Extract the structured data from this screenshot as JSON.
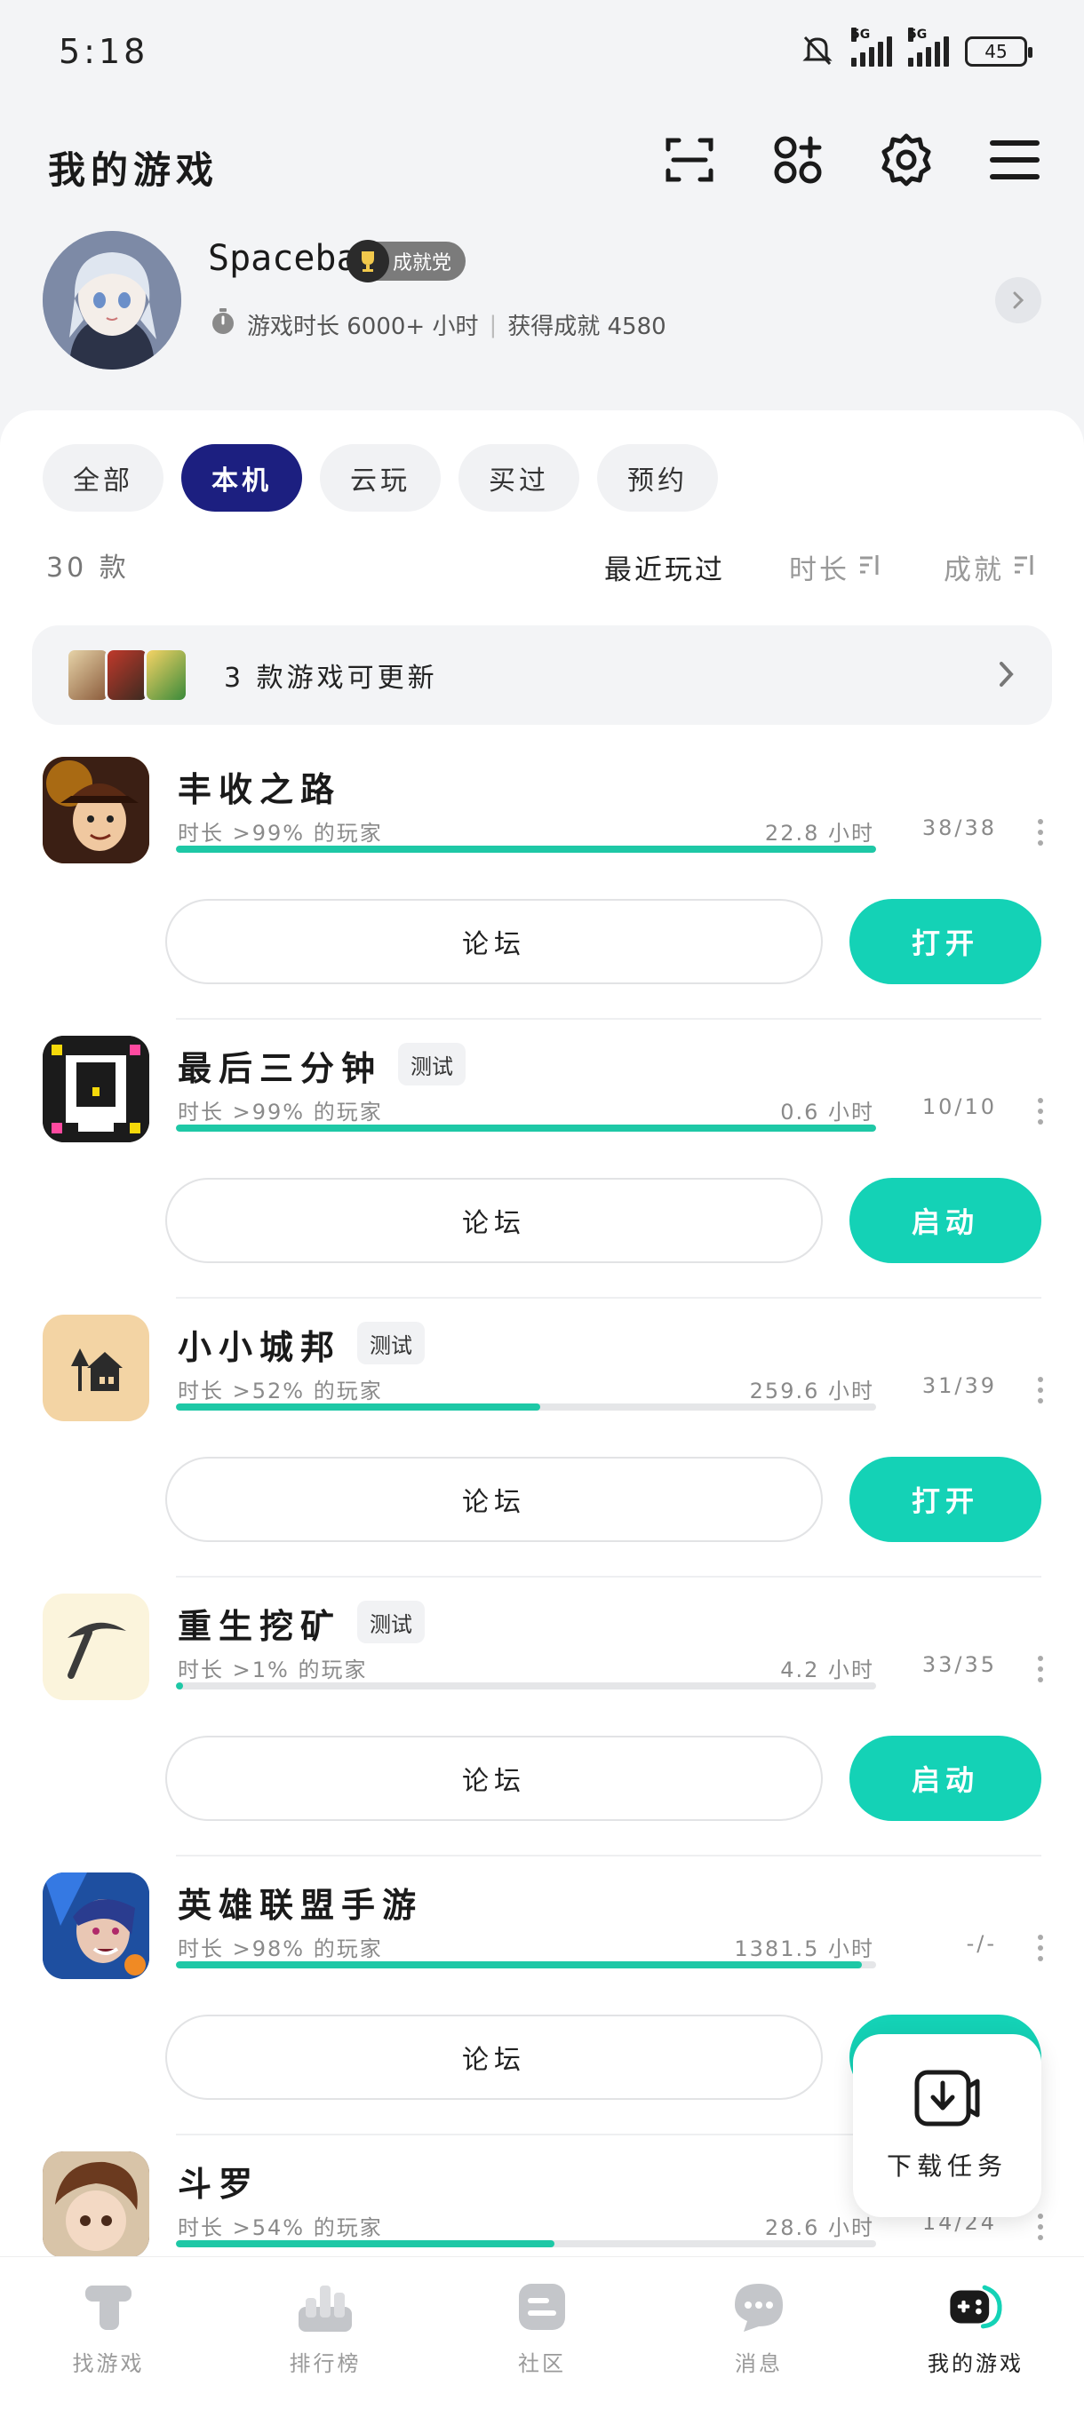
{
  "status_bar": {
    "time": "5:18",
    "network_1": "5G",
    "network_2": "5G",
    "battery": "45"
  },
  "header": {
    "title": "我的游戏"
  },
  "profile": {
    "username": "Spacebar",
    "badge_label": "成就党",
    "stats_playtime": "游戏时长 6000+ 小时",
    "stats_separator": "|",
    "stats_achievements": "获得成就 4580"
  },
  "filters": {
    "tabs": [
      {
        "label": "全部"
      },
      {
        "label": "本机"
      },
      {
        "label": "云玩"
      },
      {
        "label": "买过"
      },
      {
        "label": "预约"
      }
    ],
    "active_index": 1
  },
  "list_meta": {
    "count": "30 款",
    "sort_recent": "最近玩过",
    "sort_duration": "时长",
    "sort_achievements": "成就"
  },
  "update_banner": {
    "text": "3 款游戏可更新"
  },
  "games": [
    {
      "name": "丰收之路",
      "test_badge": "",
      "sub": "时长 >99% 的玩家",
      "hours": "22.8 小时",
      "achievements": "38/38",
      "progress": 1.0,
      "forum_label": "论坛",
      "action_label": "打开"
    },
    {
      "name": "最后三分钟",
      "test_badge": "测试",
      "sub": "时长 >99% 的玩家",
      "hours": "0.6 小时",
      "achievements": "10/10",
      "progress": 1.0,
      "forum_label": "论坛",
      "action_label": "启动"
    },
    {
      "name": "小小城邦",
      "test_badge": "测试",
      "sub": "时长 >52% 的玩家",
      "hours": "259.6 小时",
      "achievements": "31/39",
      "progress": 0.52,
      "forum_label": "论坛",
      "action_label": "打开"
    },
    {
      "name": "重生挖矿",
      "test_badge": "测试",
      "sub": "时长 >1% 的玩家",
      "hours": "4.2 小时",
      "achievements": "33/35",
      "progress": 0.01,
      "forum_label": "论坛",
      "action_label": "启动"
    },
    {
      "name": "英雄联盟手游",
      "test_badge": "",
      "sub": "时长 >98% 的玩家",
      "hours": "1381.5 小时",
      "achievements": "-/-",
      "progress": 0.98,
      "forum_label": "论坛",
      "action_label": ""
    },
    {
      "name": "斗罗",
      "test_badge": "",
      "sub": "时长 >54% 的玩家",
      "hours": "28.6 小时",
      "achievements": "14/24",
      "progress": 0.54,
      "forum_label": "",
      "action_label": ""
    }
  ],
  "download_fab": {
    "label": "下载任务"
  },
  "bottom_nav": {
    "items": [
      {
        "label": "找游戏",
        "icon": "t-icon"
      },
      {
        "label": "排行榜",
        "icon": "ranking-icon"
      },
      {
        "label": "社区",
        "icon": "community-icon"
      },
      {
        "label": "消息",
        "icon": "message-icon"
      },
      {
        "label": "我的游戏",
        "icon": "gamepad-icon"
      }
    ],
    "active_index": 4
  },
  "colors": {
    "accent": "#14d2b6",
    "active_tab": "#1c1f80",
    "progress": "#1ec8a6"
  }
}
